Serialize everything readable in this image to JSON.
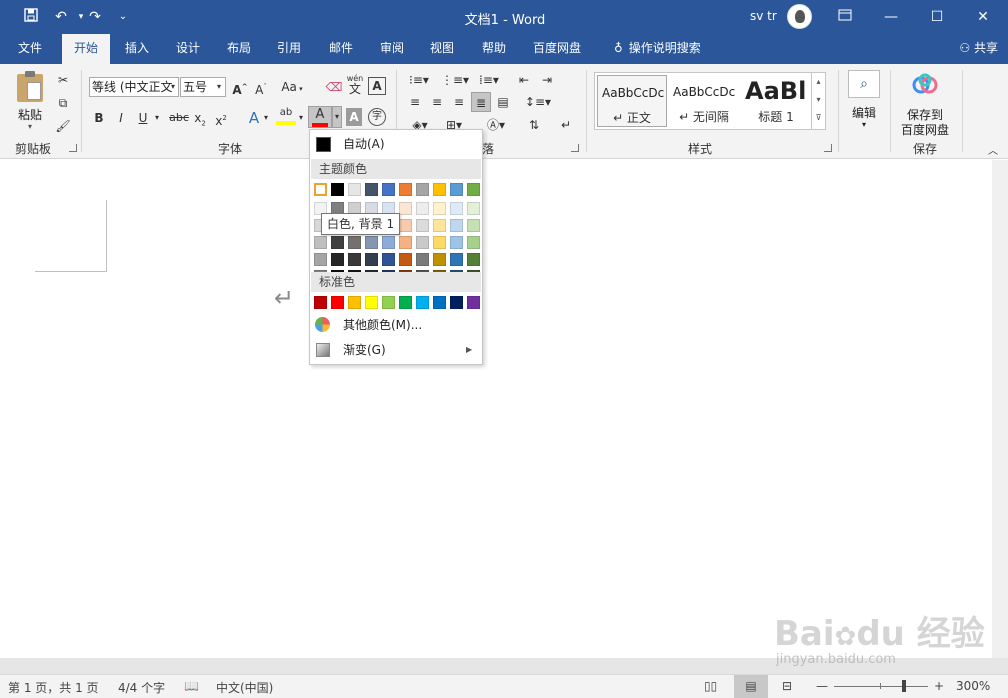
{
  "title_bar": {
    "document_title": "文档1  -  Word",
    "user_name": "sv tr"
  },
  "tabs": [
    "文件",
    "开始",
    "插入",
    "设计",
    "布局",
    "引用",
    "邮件",
    "审阅",
    "视图",
    "帮助",
    "百度网盘"
  ],
  "active_tab": "开始",
  "tell_me": "操作说明搜索",
  "share_label": "共享",
  "ribbon": {
    "clipboard": {
      "paste_label": "粘贴",
      "group_label": "剪贴板"
    },
    "font": {
      "font_name": "等线 (中文正文",
      "font_size": "五号",
      "change_case": "Aa",
      "pinyin": "wén",
      "group_label": "字体"
    },
    "paragraph": {
      "group_label": "落"
    },
    "styles": {
      "items": [
        {
          "sample": "AaBbCcDc",
          "name": "↵ 正文"
        },
        {
          "sample": "AaBbCcDc",
          "name": "↵ 无间隔"
        },
        {
          "sample": "AaBl",
          "name": "标题 1"
        }
      ],
      "group_label": "样式"
    },
    "editing": {
      "label": "编辑"
    },
    "save": {
      "label_line1": "保存到",
      "label_line2": "百度网盘",
      "group_label": "保存"
    }
  },
  "font_color_menu": {
    "auto_label": "自动(A)",
    "theme_header": "主题颜色",
    "standard_header": "标准色",
    "more_colors": "其他颜色(M)...",
    "gradient": "渐变(G)",
    "tooltip": "白色, 背景 1",
    "theme_top_row": [
      "#ffffff",
      "#000000",
      "#e7e6e6",
      "#44546a",
      "#4472c4",
      "#ed7d31",
      "#a5a5a5",
      "#ffc000",
      "#5b9bd5",
      "#70ad47"
    ],
    "theme_shades": [
      [
        "#f2f2f2",
        "#7f7f7f",
        "#d0cece",
        "#d6dce4",
        "#d9e2f3",
        "#fbe5d5",
        "#ededed",
        "#fff2cc",
        "#deebf6",
        "#e2efd9"
      ],
      [
        "#d8d8d8",
        "#595959",
        "#aeabab",
        "#adb9ca",
        "#b4c6e7",
        "#f7cbac",
        "#dbdbdb",
        "#fee599",
        "#bdd7ee",
        "#c5e0b3"
      ],
      [
        "#bfbfbf",
        "#3f3f3f",
        "#757070",
        "#8496b0",
        "#8eaadb",
        "#f4b183",
        "#c9c9c9",
        "#ffd965",
        "#9dc3e6",
        "#a8d08d"
      ],
      [
        "#a5a5a5",
        "#262626",
        "#3a3838",
        "#323f4f",
        "#2f5496",
        "#c55a11",
        "#7b7b7b",
        "#bf9000",
        "#2e75b5",
        "#538135"
      ],
      [
        "#7f7f7f",
        "#0c0c0c",
        "#171616",
        "#222a35",
        "#1f3763",
        "#833c0b",
        "#525252",
        "#7f6000",
        "#1e4e79",
        "#375623"
      ]
    ],
    "standard": [
      "#c00000",
      "#ff0000",
      "#ffc000",
      "#ffff00",
      "#92d050",
      "#00b050",
      "#00b0f0",
      "#0070c0",
      "#002060",
      "#7030a0"
    ]
  },
  "status_bar": {
    "page": "第 1 页，共 1 页",
    "words": "4/4 个字",
    "language": "中文(中国)",
    "zoom": "300%"
  },
  "watermark": {
    "logo": "Baidu 经验",
    "url": "jingyan.baidu.com"
  }
}
